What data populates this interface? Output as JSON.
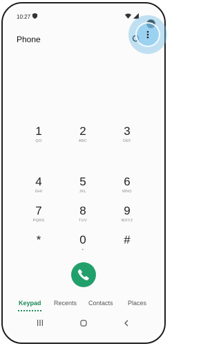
{
  "status_bar": {
    "time": "10:27",
    "left_icon": "shield-icon",
    "right_icons": [
      "wifi-icon",
      "signal-icon",
      "battery-icon"
    ]
  },
  "app": {
    "title": "Phone",
    "search_icon": "search-icon",
    "more_icon": "more-options-icon"
  },
  "keypad": {
    "keys": [
      {
        "digit": "1",
        "letters": "QO"
      },
      {
        "digit": "2",
        "letters": "ABC"
      },
      {
        "digit": "3",
        "letters": "DEF"
      },
      {
        "digit": "4",
        "letters": "GHI"
      },
      {
        "digit": "5",
        "letters": "JKL"
      },
      {
        "digit": "6",
        "letters": "MNO"
      },
      {
        "digit": "7",
        "letters": "PQRS"
      },
      {
        "digit": "8",
        "letters": "TUV"
      },
      {
        "digit": "9",
        "letters": "WXYZ"
      },
      {
        "digit": "*",
        "letters": ""
      },
      {
        "digit": "0",
        "letters": "+"
      },
      {
        "digit": "#",
        "letters": ""
      }
    ]
  },
  "call_button": {
    "icon": "phone-icon",
    "color": "#22a06b"
  },
  "tabs": [
    {
      "label": "Keypad",
      "active": true
    },
    {
      "label": "Recents",
      "active": false
    },
    {
      "label": "Contacts",
      "active": false
    },
    {
      "label": "Places",
      "active": false
    }
  ],
  "accent_color": "#1c8a5a",
  "nav_bar": {
    "recents": "|||",
    "home": "○",
    "back": "‹"
  }
}
